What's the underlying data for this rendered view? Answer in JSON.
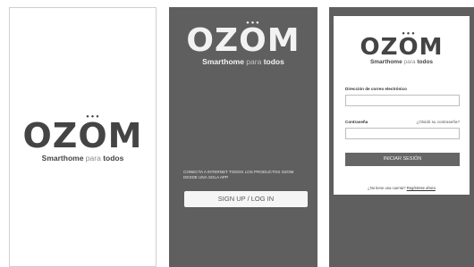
{
  "splash": {
    "logo": {
      "word_before": "OZ",
      "word_o": "O",
      "word_after": "M",
      "tag_bold": "Smarthome",
      "tag_light": "para",
      "tag_end": "todos"
    }
  },
  "welcome": {
    "logo": {
      "word_before": "OZ",
      "word_o": "O",
      "word_after": "M",
      "tag_bold": "Smarthome",
      "tag_light": "para",
      "tag_end": "todos"
    },
    "consent_text": "Conecta a internet todos los productos ozom desde una sola app",
    "signup_label": "SIGN UP / LOG IN"
  },
  "login": {
    "logo": {
      "word_before": "OZ",
      "word_o": "O",
      "word_after": "M",
      "tag_bold": "Smarthome",
      "tag_light": "para",
      "tag_end": "todos"
    },
    "email_label": "Dirección de correo electrónico",
    "email_value": "",
    "password_label": "Contraseña",
    "forgot_label": "¿Olvidó su contraseña?",
    "password_value": "",
    "login_label": "INICIAR SESIÓN",
    "register_prompt": "¿No tiene una cuenta?",
    "register_link": "Regístrese ahora"
  },
  "colors": {
    "dark_bg": "#5f5f5f",
    "brand_gray": "#444444",
    "button_gray": "#666666"
  }
}
